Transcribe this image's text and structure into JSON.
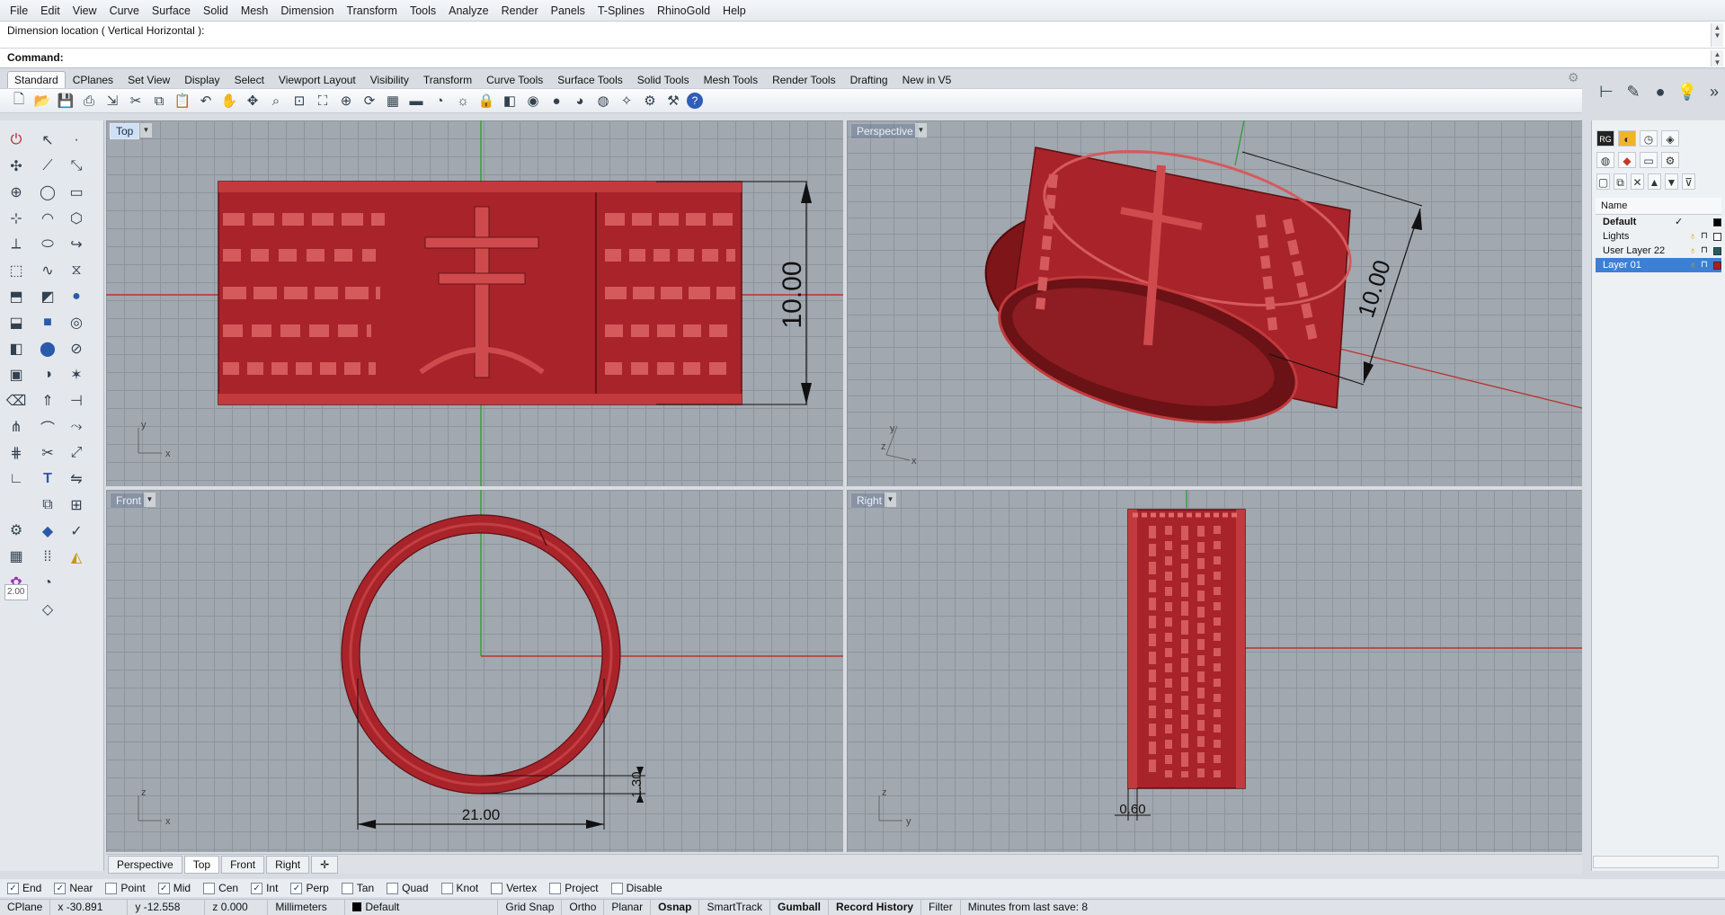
{
  "menu": [
    "File",
    "Edit",
    "View",
    "Curve",
    "Surface",
    "Solid",
    "Mesh",
    "Dimension",
    "Transform",
    "Tools",
    "Analyze",
    "Render",
    "Panels",
    "T-Splines",
    "RhinoGold",
    "Help"
  ],
  "command": {
    "history": "Dimension location ( Vertical  Horizontal ):",
    "prompt": "Command:"
  },
  "toolbar_tabs": [
    "Standard",
    "CPlanes",
    "Set View",
    "Display",
    "Select",
    "Viewport Layout",
    "Visibility",
    "Transform",
    "Curve Tools",
    "Surface Tools",
    "Solid Tools",
    "Mesh Tools",
    "Render Tools",
    "Drafting",
    "New in V5"
  ],
  "toolbar_icons": [
    "new-icon",
    "open-icon",
    "save-icon",
    "print-icon",
    "import-icon",
    "cut-icon",
    "copy-icon",
    "paste-icon",
    "undo-icon",
    "pan-icon",
    "move-view-icon",
    "zoom-icon",
    "zoom-window-icon",
    "zoom-extents-icon",
    "zoom-selected-icon",
    "rotate-view-icon",
    "grid-icon",
    "car-icon",
    "render-icon",
    "light-icon",
    "lock-icon",
    "layer-icon",
    "color-wheel-icon",
    "shade-icon",
    "material-icon",
    "globe-icon",
    "bulb-icon",
    "options-icon",
    "tools-icon",
    "help-icon"
  ],
  "viewports": {
    "top": {
      "label": "Top",
      "dimension": "10.00",
      "axis_x": "x",
      "axis_y": "y"
    },
    "perspective": {
      "label": "Perspective",
      "dimension": "10.00",
      "axis_x": "x",
      "axis_y": "y",
      "axis_z": "z"
    },
    "front": {
      "label": "Front",
      "dim_width": "21.00",
      "dim_thickness": "1.30",
      "axis_x": "x",
      "axis_z": "z"
    },
    "right": {
      "label": "Right",
      "dim_width": "0.60",
      "axis_y": "y",
      "axis_z": "z"
    }
  },
  "viewport_tabs": [
    "Perspective",
    "Top",
    "Front",
    "Right"
  ],
  "viewport_tab_active": "Top",
  "left_tool_value": "2.00",
  "osnaps": [
    {
      "label": "End",
      "checked": true
    },
    {
      "label": "Near",
      "checked": true
    },
    {
      "label": "Point",
      "checked": false
    },
    {
      "label": "Mid",
      "checked": true
    },
    {
      "label": "Cen",
      "checked": false
    },
    {
      "label": "Int",
      "checked": true
    },
    {
      "label": "Perp",
      "checked": true
    },
    {
      "label": "Tan",
      "checked": false
    },
    {
      "label": "Quad",
      "checked": false
    },
    {
      "label": "Knot",
      "checked": false
    },
    {
      "label": "Vertex",
      "checked": false
    },
    {
      "label": "Project",
      "checked": false
    },
    {
      "label": "Disable",
      "checked": false
    }
  ],
  "status": {
    "cplane": "CPlane",
    "x": "x -30.891",
    "y": "y -12.558",
    "z": "z 0.000",
    "units": "Millimeters",
    "layer": "Default",
    "grid_snap": "Grid Snap",
    "ortho": "Ortho",
    "planar": "Planar",
    "osnap": "Osnap",
    "smarttrack": "SmartTrack",
    "gumball": "Gumball",
    "record_history": "Record History",
    "filter": "Filter",
    "save_info": "Minutes from last save: 8"
  },
  "layers": {
    "header": "Name",
    "items": [
      {
        "name": "Default",
        "current": true,
        "color": "#000000"
      },
      {
        "name": "Lights",
        "current": false,
        "color": "#ffffff"
      },
      {
        "name": "User Layer 22",
        "current": false,
        "color": "#1f5f66"
      },
      {
        "name": "Layer 01",
        "current": false,
        "color": "#b31b1b",
        "selected": true
      }
    ]
  },
  "colors": {
    "ring": "#a8242a",
    "ring_light": "#cf4a4c",
    "axis_red": "#b8322e",
    "axis_green": "#2f9e3a",
    "viewport_bg": "#a2a8af",
    "selection": "#3d7fd3"
  }
}
